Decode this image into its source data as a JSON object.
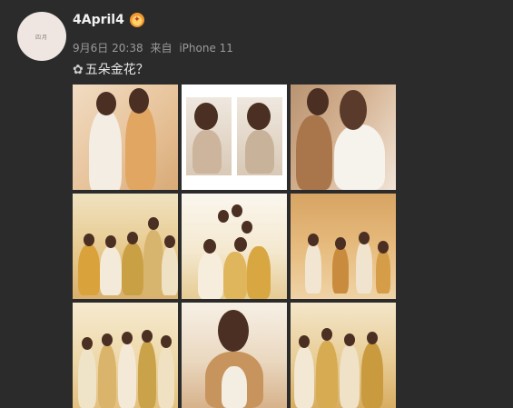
{
  "post": {
    "username": "4April4",
    "badge_icon": "fortune-badge-icon",
    "avatar_text": "四月",
    "date": "9月6日 20:38",
    "source_prefix": "来自",
    "source_device": "iPhone 11",
    "text_icon": "✿",
    "text": "五朵金花？"
  },
  "photos": [
    {
      "name": "photo-1"
    },
    {
      "name": "photo-2"
    },
    {
      "name": "photo-3"
    },
    {
      "name": "photo-4"
    },
    {
      "name": "photo-5"
    },
    {
      "name": "photo-6"
    },
    {
      "name": "photo-7"
    },
    {
      "name": "photo-8"
    },
    {
      "name": "photo-9"
    }
  ]
}
